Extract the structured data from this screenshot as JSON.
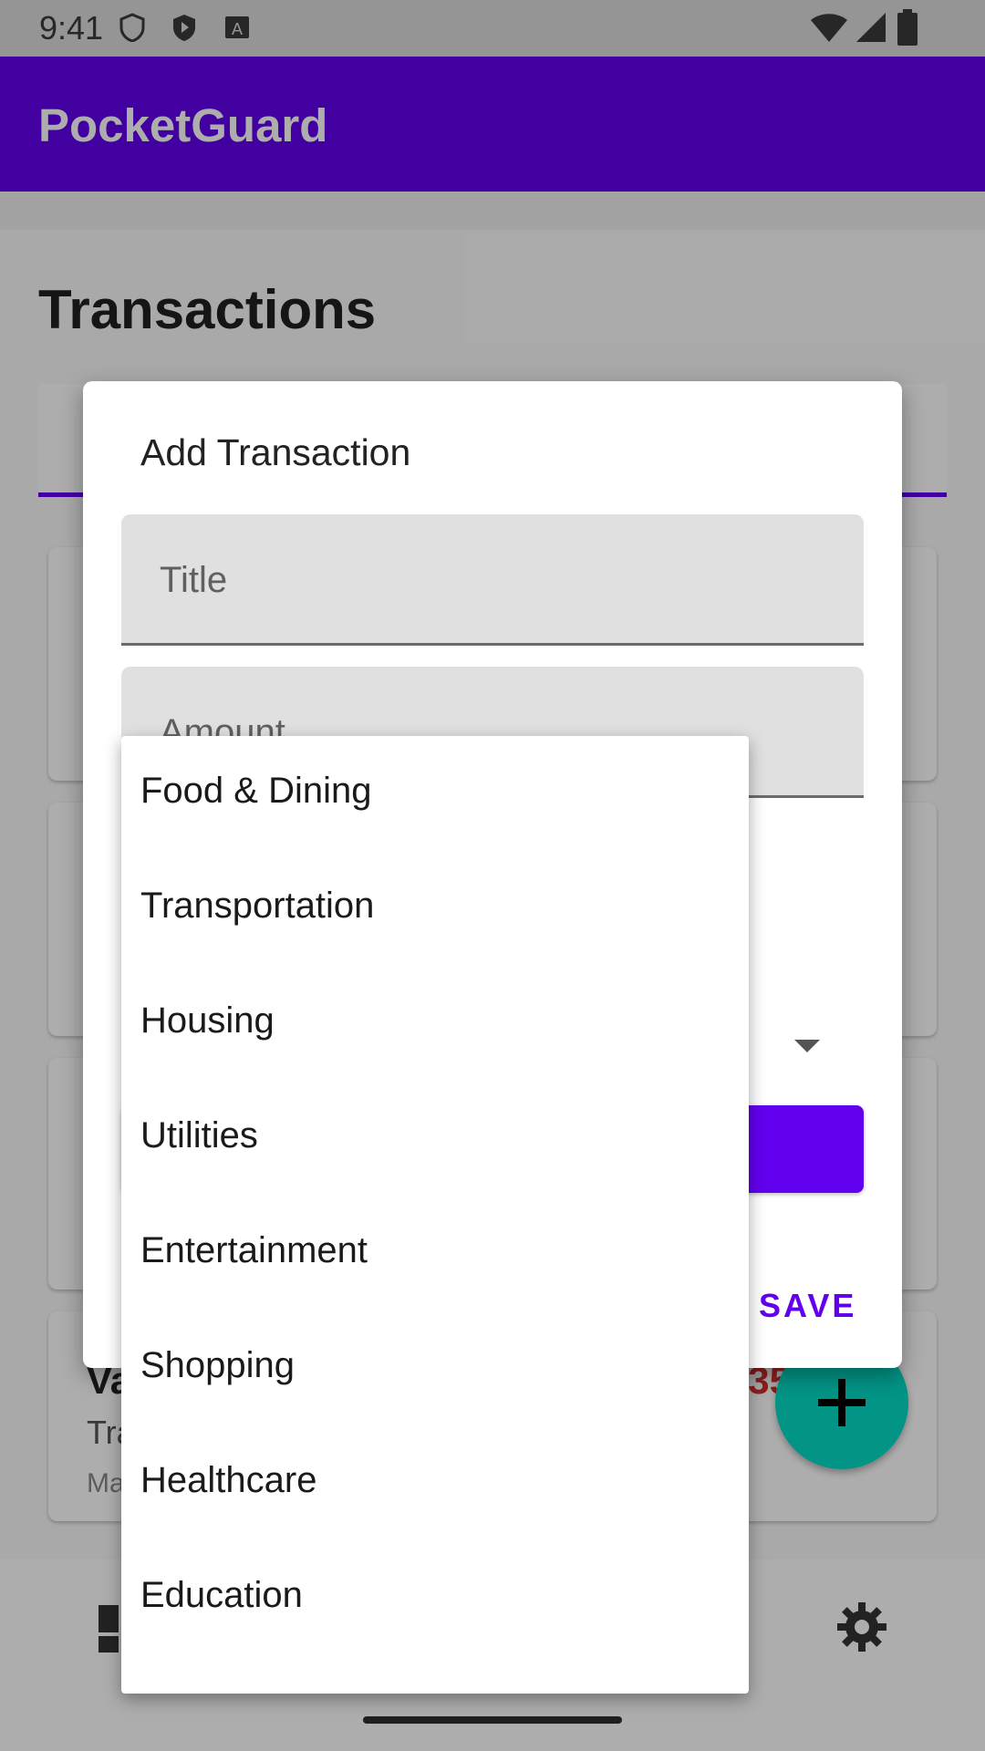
{
  "status_bar": {
    "time": "9:41"
  },
  "app": {
    "title": "PocketGuard"
  },
  "screen": {
    "title": "Transactions"
  },
  "cards": [
    {
      "title": "Va",
      "subtitle": "Tra",
      "date": "Ma",
      "amount": "35"
    }
  ],
  "dialog": {
    "title": "Add Transaction",
    "title_field": {
      "label": "Title"
    },
    "amount_field": {
      "label": "Amount"
    },
    "save_label": "SAVE"
  },
  "menu": {
    "items": [
      "Food & Dining",
      "Transportation",
      "Housing",
      "Utilities",
      "Entertainment",
      "Shopping",
      "Healthcare",
      "Education"
    ]
  },
  "colors": {
    "primary": "#6200ee",
    "accent": "#03dac5",
    "expense": "#d32f2f"
  },
  "icons": [
    "shield-icon",
    "play-protect-icon",
    "keyboard-icon",
    "wifi-icon",
    "signal-icon",
    "battery-icon",
    "add-icon",
    "settings-icon",
    "dashboard-icon",
    "dropdown-arrow-icon"
  ]
}
